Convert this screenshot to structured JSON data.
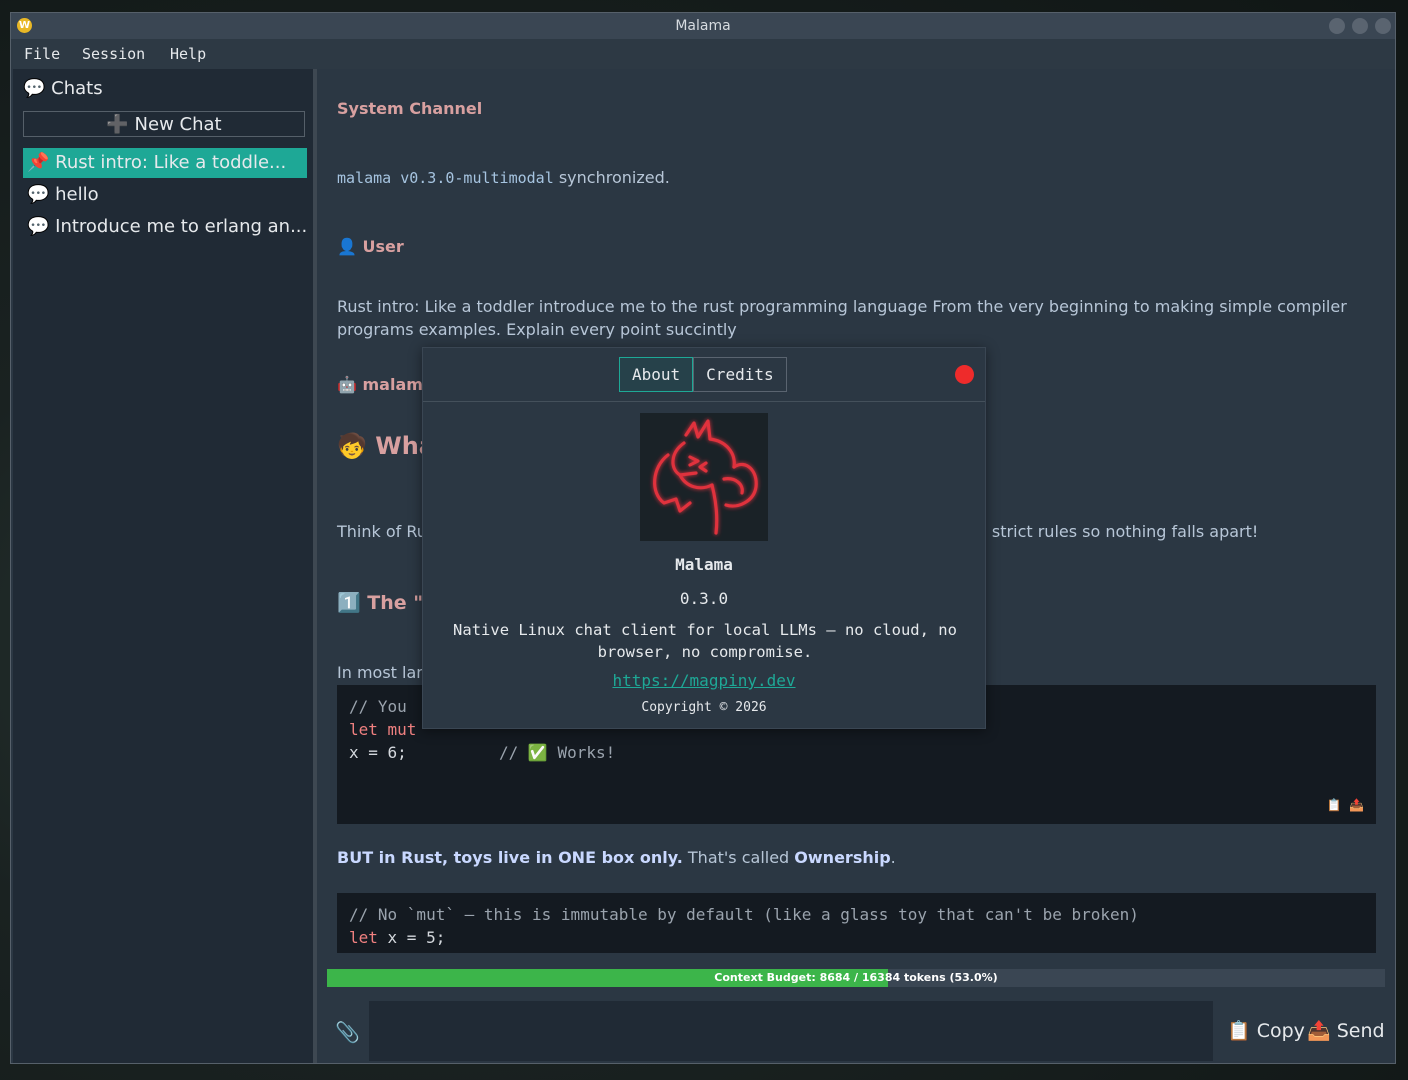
{
  "window": {
    "title": "Malama",
    "app_icon_glyph": "W"
  },
  "menubar": {
    "items": [
      "File",
      "Session",
      "Help"
    ]
  },
  "sidebar": {
    "heading": "💬 Chats",
    "new_chat_label": "➕ New Chat",
    "chats": [
      {
        "label": "📌 Rust intro: Like a toddle...",
        "active": true
      },
      {
        "label": "💬 hello",
        "active": false
      },
      {
        "label": "💬 Introduce me to erlang an...",
        "active": false
      }
    ]
  },
  "conversation": {
    "system_title": "System Channel",
    "sync_code": "malama v0.3.0-multimodal",
    "sync_text": " synchronized.",
    "user_header": "👤 User",
    "user_message": "Rust intro: Like a toddler introduce me to the rust programming language From the very beginning to making simple compiler programs examples. Explain every point succintly",
    "bot_header": "🤖 malama",
    "heading1": "🧒 Wha",
    "para1_left": "Think of Ru",
    "para1_right": "e strict rules so nothing falls apart!",
    "heading2": "1️⃣ The \"V",
    "para2": "In most lan",
    "code1": {
      "line1": "// You",
      "line2_kw": "let mut",
      "line3_code": "x = 6;",
      "line3_comment": "// ✅ Works!"
    },
    "ownership": {
      "bold1": "BUT in Rust, toys live in ONE box only.",
      "text": " That's called ",
      "bold2": "Ownership",
      "end": "."
    },
    "code2": {
      "line1": "// No `mut` — this is immutable by default (like a glass toy that can't be broken)",
      "line2_kw": "let",
      "line2_rest": " x = 5;"
    },
    "code_icons": "📋 📤"
  },
  "budget": {
    "text": "Context Budget: 8684 / 16384 tokens (53.0%)",
    "fraction": 0.53
  },
  "composer": {
    "attach_icon": "📎",
    "copy_label": "📋 Copy",
    "send_label": "📤 Send"
  },
  "about_dialog": {
    "tabs": [
      "About",
      "Credits"
    ],
    "active_tab": "About",
    "name": "Malama",
    "version": "0.3.0",
    "description": "Native Linux chat client for local LLMs — no cloud, no browser, no compromise.",
    "link": "https://magpiny.dev",
    "copyright": "Copyright © 2026"
  },
  "colors": {
    "accent": "#1ea896",
    "budget_fill": "#3cb54a",
    "heading": "#d8a0a0",
    "close": "#ee2b2b"
  }
}
